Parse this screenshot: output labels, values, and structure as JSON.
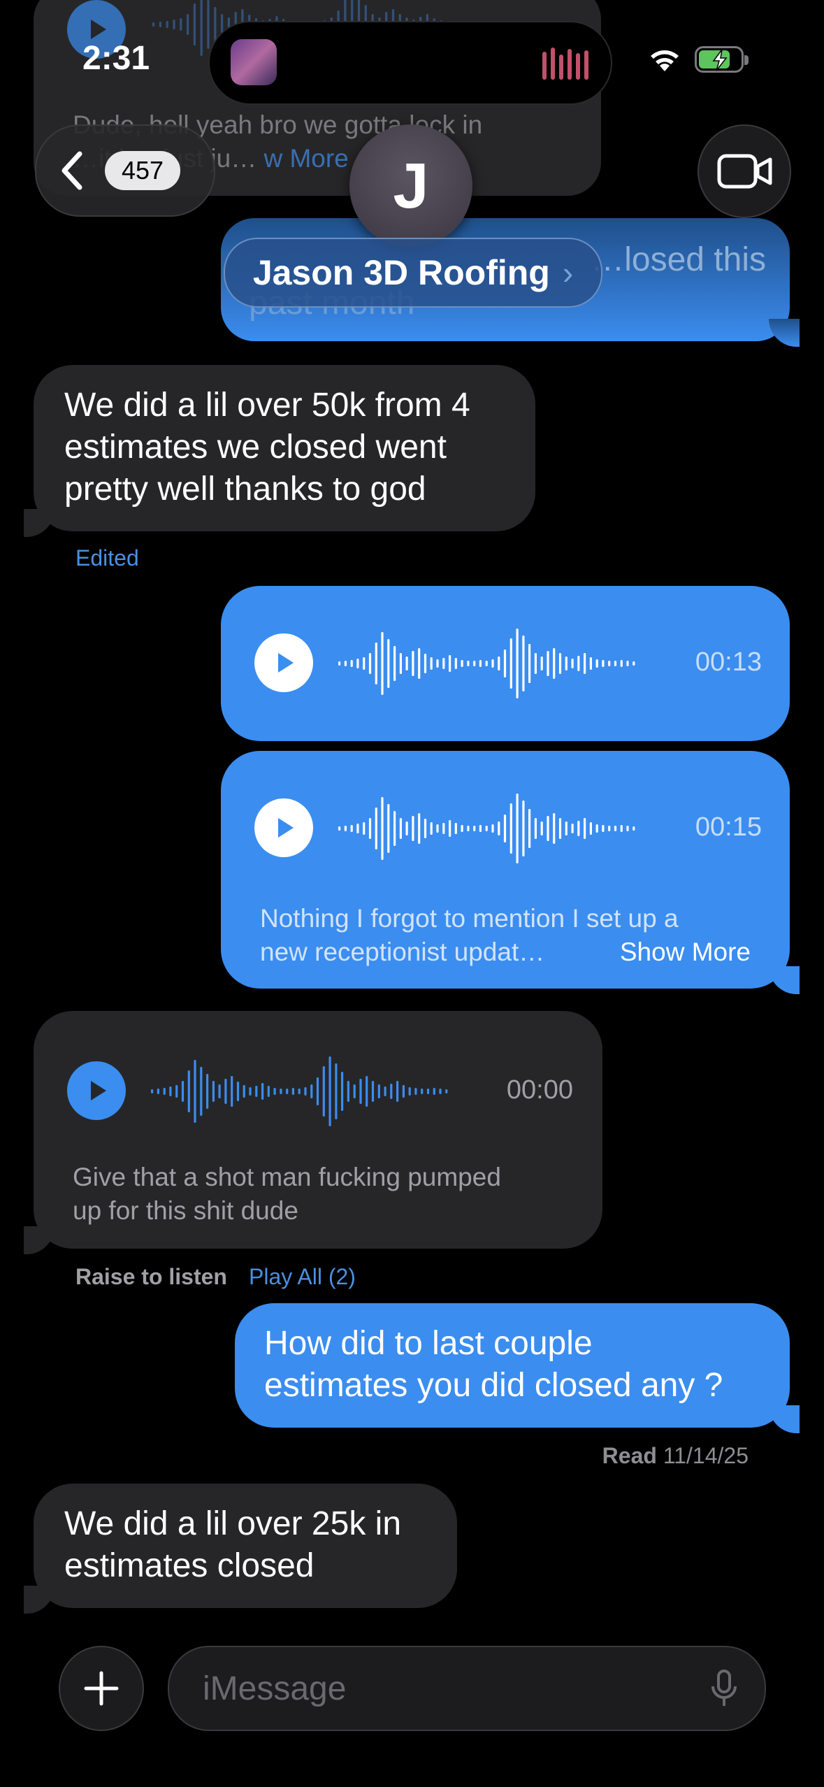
{
  "status_bar": {
    "time": "2:31"
  },
  "header": {
    "back_count": "457",
    "avatar_initial": "J",
    "contact_name": "Jason 3D Roofing",
    "chevron": "›"
  },
  "top_partial": {
    "line1": "Dude, hell yeah bro we gotta lock in",
    "line2": "…it bro just ju…",
    "show_more": "w More",
    "out_line1": "…losed this",
    "out_line2": "past month"
  },
  "messages": {
    "m1": {
      "lines": [
        "We did a lil over 50k from 4",
        "estimates we closed went",
        "pretty well thanks to god"
      ],
      "edited": "Edited"
    },
    "v1": {
      "duration": "00:13"
    },
    "v2": {
      "duration": "00:15",
      "transcript1": "Nothing I forgot to mention I set up a",
      "transcript2": "new receptionist updat…",
      "show_more": "Show More"
    },
    "v3": {
      "duration": "00:00",
      "transcript1": "Give that a shot man fucking pumped",
      "transcript2": "up for this shit dude"
    },
    "raise": "Raise to listen",
    "play_all": "Play All (2)",
    "m2": {
      "lines": [
        "How did to last couple",
        "estimates you did closed any ?"
      ]
    },
    "read_label": "Read",
    "read_date": "11/14/25",
    "m3": {
      "lines": [
        "We did a lil over 25k in",
        "estimates closed"
      ]
    }
  },
  "composer": {
    "placeholder": "iMessage"
  },
  "colors": {
    "accent": "#3b8df0",
    "incoming": "#262628",
    "link": "#4a90e2"
  }
}
